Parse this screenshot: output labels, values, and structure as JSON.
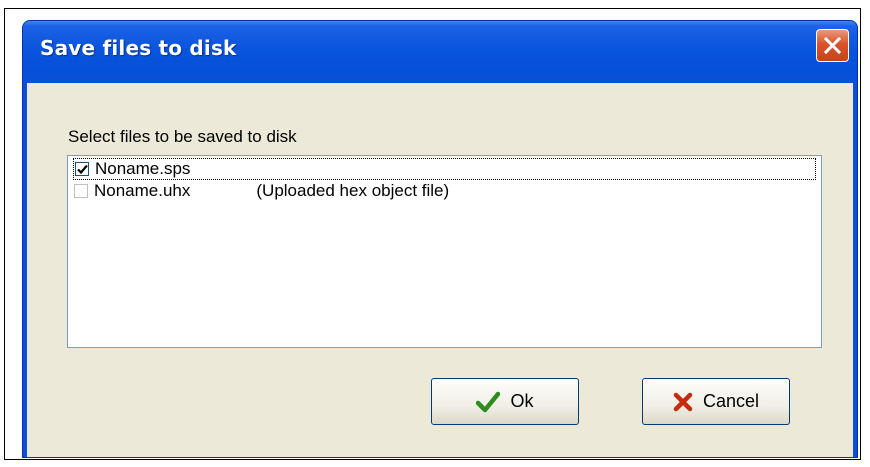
{
  "window": {
    "title": "Save files to disk",
    "close_icon": "close-icon"
  },
  "dialog": {
    "prompt": "Select files to be saved to disk",
    "files": [
      {
        "name": "Noname.sps",
        "description": "",
        "checked": true
      },
      {
        "name": "Noname.uhx",
        "description": "(Uploaded hex object file)",
        "checked": false
      }
    ]
  },
  "buttons": {
    "ok_label": "Ok",
    "ok_icon": "checkmark-icon",
    "cancel_label": "Cancel",
    "cancel_icon": "x-mark-icon"
  },
  "colors": {
    "titlebar": "#0a55dd",
    "close_button": "#d9542a",
    "dialog_face": "#ece9d8",
    "ok_icon": "#2e8b1e",
    "cancel_icon": "#c62b10"
  }
}
